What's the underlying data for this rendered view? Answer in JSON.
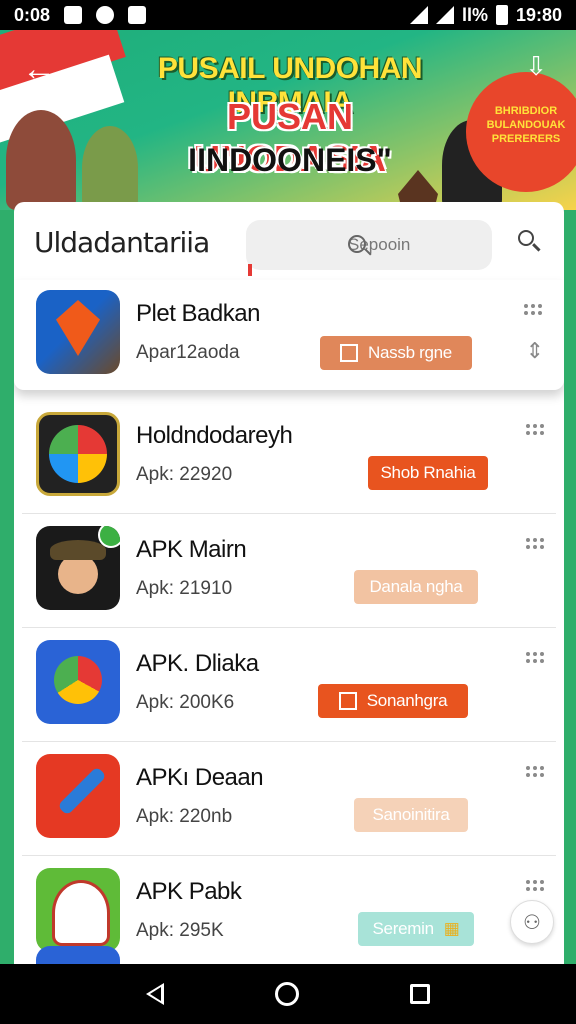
{
  "status_bar": {
    "time_left": "0:08",
    "time_right": "19:80",
    "battery_text": "ll%"
  },
  "banner": {
    "back_icon": "back-arrow-icon",
    "line1": "PUSAIL UNDOHAN INRMAIA",
    "line2": "PUSAN UNODASIA",
    "line3": "IINDOONEIS\"",
    "badge_text": "BHRIBDIOR BULANDOUAK PRERERERS",
    "download_icon": "download-icon",
    "colors": {
      "title": "#ffe23a",
      "subtitle": "#e53935",
      "badge": "#e8462b"
    }
  },
  "header": {
    "title": "Uldadantariia",
    "search_placeholder": "Sepooin",
    "search_icon": "search-icon"
  },
  "apps": [
    {
      "name": "Plet Badkan",
      "meta": "Apar12aoda",
      "action": "Nassb rgne",
      "action_color": "#e0875a",
      "icon": "kite-app-icon"
    },
    {
      "name": "Holdndodareyh",
      "meta": "Apk: 22920",
      "action": "Shob Rnahia",
      "action_color": "#e8541f",
      "icon": "color-wheel-app-icon"
    },
    {
      "name": "APK Mairn",
      "meta": "Apk: 21910",
      "action": "Danala ngha",
      "action_color": "#f2c3a2",
      "icon": "character-app-icon"
    },
    {
      "name": "APK. Dliaka",
      "meta": "Apk: 200K6",
      "action": "Sonanhgra",
      "action_color": "#e8541f",
      "icon": "chrome-app-icon"
    },
    {
      "name": "APKı Deaan",
      "meta": "Apk: 220nb",
      "action": "Sanoinitira",
      "action_color": "#f5d2b8",
      "icon": "pencil-app-icon"
    },
    {
      "name": "APK Pabk",
      "meta": "Apk: 295K",
      "action": "Seremin",
      "action_color": "#a8e3d8",
      "icon": "avatar-app-icon"
    }
  ],
  "nav": {
    "back_icon": "nav-back-icon",
    "home_icon": "nav-home-icon",
    "recent_icon": "nav-recent-icon"
  }
}
